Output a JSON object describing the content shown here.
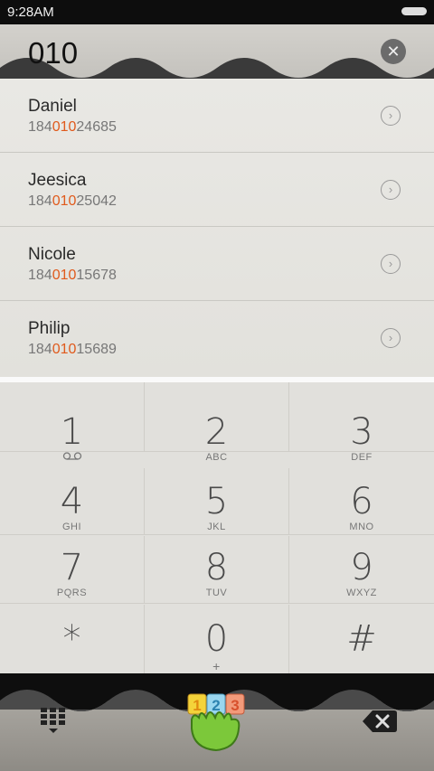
{
  "status_bar": {
    "time": "9:28AM"
  },
  "search": {
    "query": "010",
    "clear_icon": "clear-icon"
  },
  "results": [
    {
      "name": "Daniel",
      "prefix": "184",
      "match": "010",
      "suffix": "24685"
    },
    {
      "name": "Jeesica",
      "prefix": "184",
      "match": "010",
      "suffix": "25042"
    },
    {
      "name": "Nicole",
      "prefix": "184",
      "match": "010",
      "suffix": "15678"
    },
    {
      "name": "Philip",
      "prefix": "184",
      "match": "010",
      "suffix": "15689"
    }
  ],
  "keypad": [
    {
      "digit": "1",
      "letters": "voicemail"
    },
    {
      "digit": "2",
      "letters": "ABC"
    },
    {
      "digit": "3",
      "letters": "DEF"
    },
    {
      "digit": "4",
      "letters": "GHI"
    },
    {
      "digit": "5",
      "letters": "JKL"
    },
    {
      "digit": "6",
      "letters": "MNO"
    },
    {
      "digit": "7",
      "letters": "PQRS"
    },
    {
      "digit": "8",
      "letters": "TUV"
    },
    {
      "digit": "9",
      "letters": "WXYZ"
    },
    {
      "digit": "*",
      "letters": ""
    },
    {
      "digit": "0",
      "letters": "+"
    },
    {
      "digit": "#",
      "letters": ""
    }
  ],
  "colors": {
    "highlight": "#e05a1c",
    "call_green": "#7cc83a"
  },
  "bottom_bar": {
    "left_icon": "dialpad-grid-icon",
    "center_icon": "call-button-icon",
    "right_icon": "backspace-icon"
  }
}
